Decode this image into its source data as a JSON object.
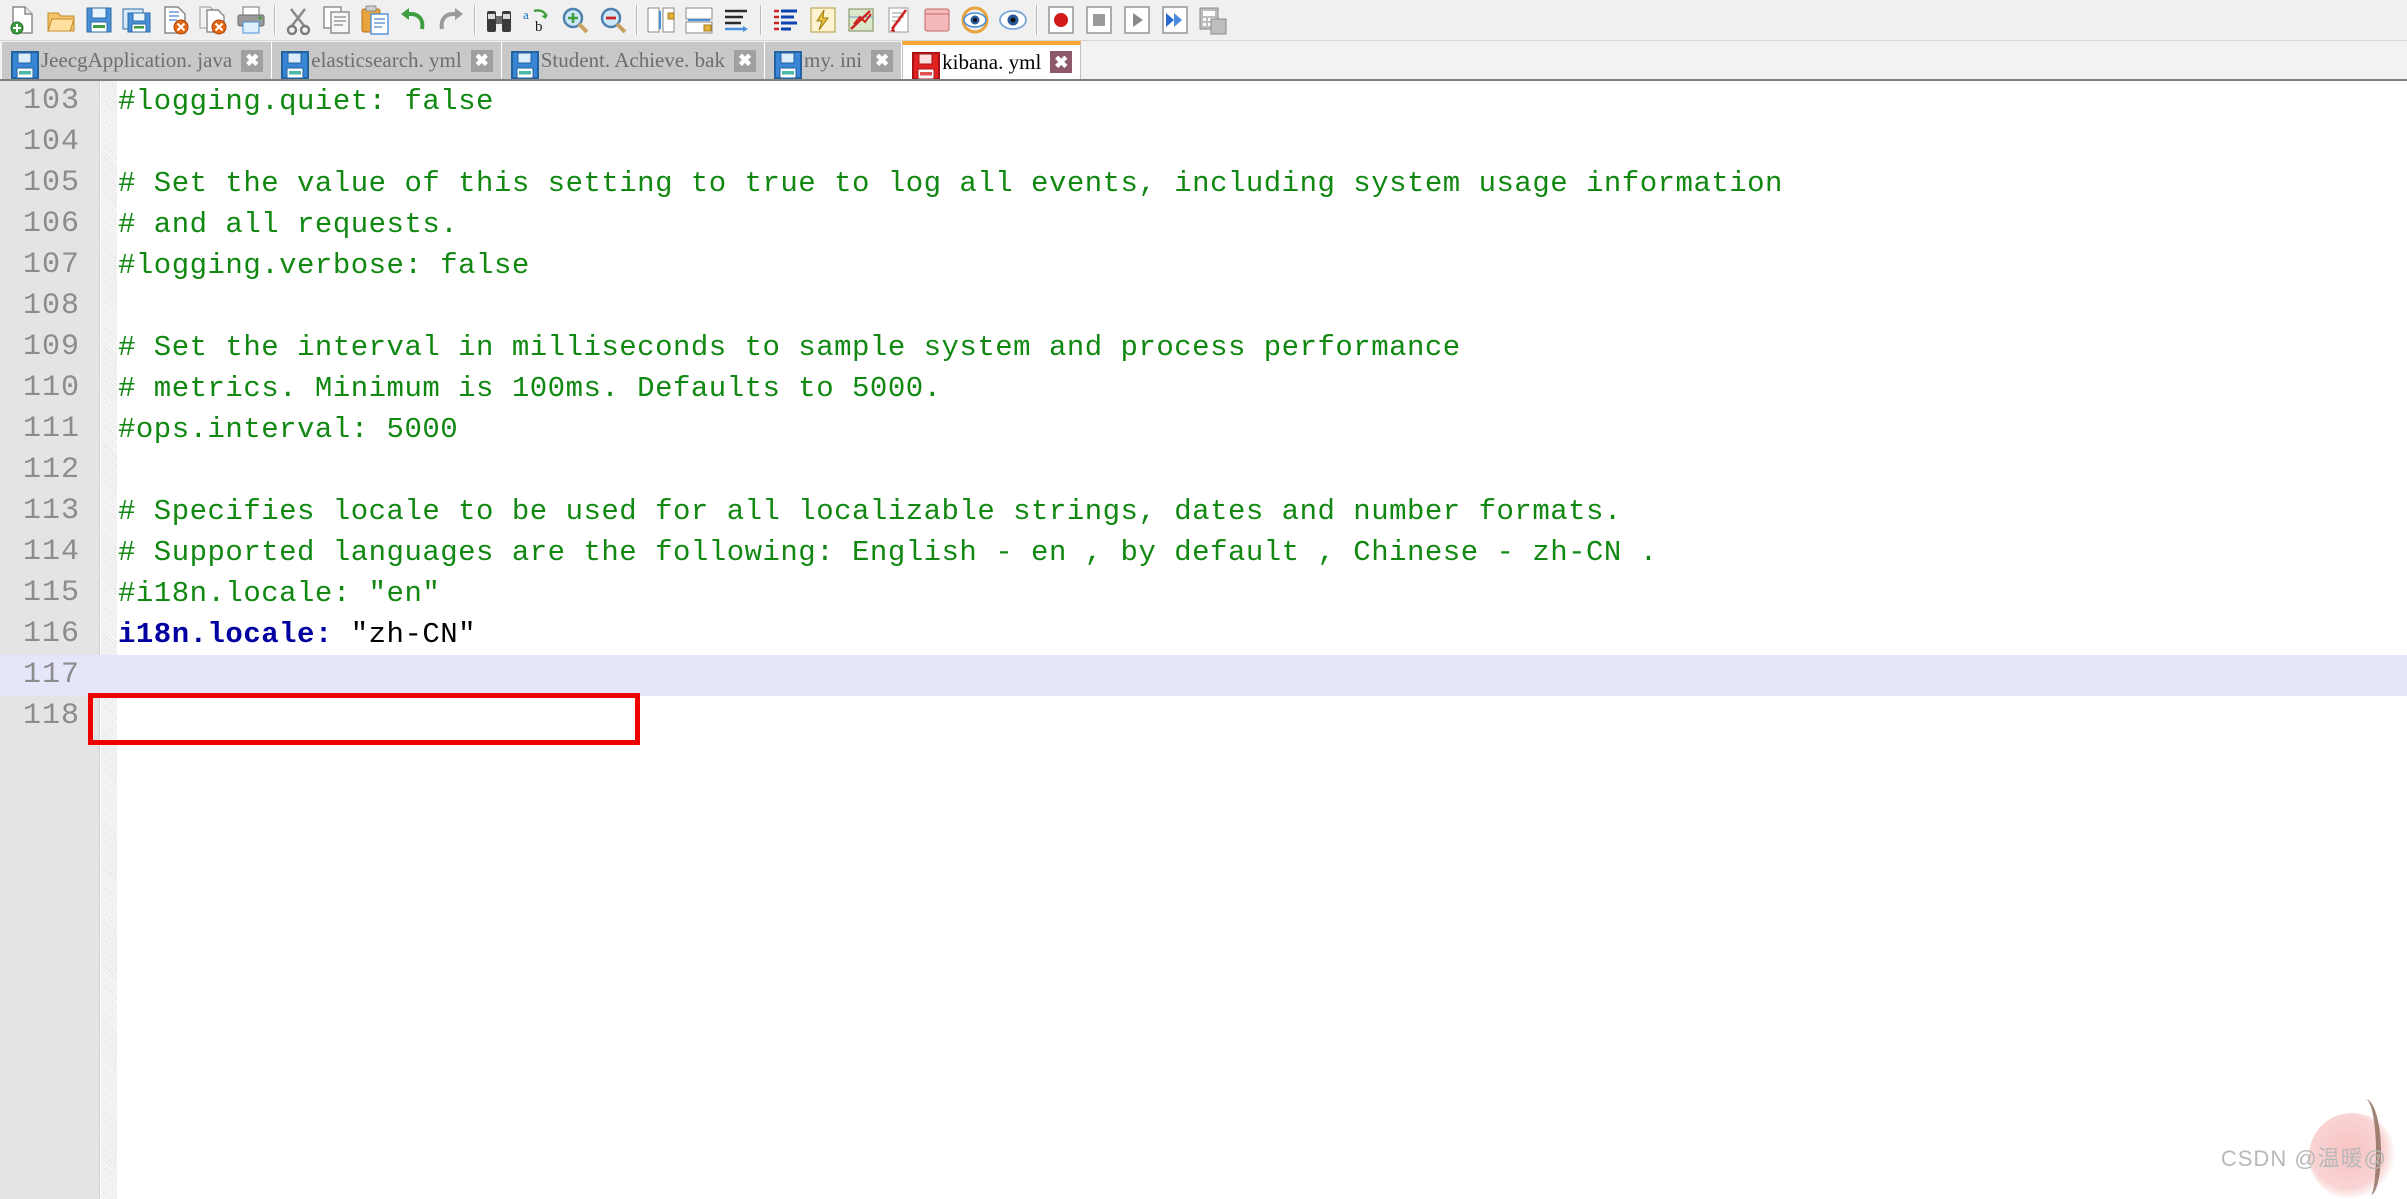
{
  "toolbar": {
    "groups": [
      {
        "buttons": [
          {
            "name": "new-file-button",
            "icon": "new-file-icon",
            "label": "New"
          },
          {
            "name": "open-file-button",
            "icon": "open-folder-icon",
            "label": "Open"
          },
          {
            "name": "save-button",
            "icon": "save-icon",
            "label": "Save"
          },
          {
            "name": "save-all-button",
            "icon": "save-all-icon",
            "label": "Save All"
          },
          {
            "name": "close-button",
            "icon": "close-document-icon",
            "label": "Close"
          },
          {
            "name": "close-all-button",
            "icon": "close-all-documents-icon",
            "label": "Close All"
          },
          {
            "name": "print-button",
            "icon": "printer-icon",
            "label": "Print"
          }
        ]
      },
      {
        "buttons": [
          {
            "name": "cut-button",
            "icon": "scissors-icon",
            "label": "Cut"
          },
          {
            "name": "copy-button",
            "icon": "copy-icon",
            "label": "Copy"
          },
          {
            "name": "paste-button",
            "icon": "paste-icon",
            "label": "Paste"
          },
          {
            "name": "undo-button",
            "icon": "undo-arrow-icon",
            "label": "Undo"
          },
          {
            "name": "redo-button",
            "icon": "redo-arrow-icon",
            "label": "Redo"
          }
        ]
      },
      {
        "buttons": [
          {
            "name": "find-button",
            "icon": "binoculars-icon",
            "label": "Find"
          },
          {
            "name": "replace-button",
            "icon": "replace-icon",
            "label": "Replace"
          },
          {
            "name": "zoom-in-button",
            "icon": "magnifier-plus-icon",
            "label": "Zoom In"
          },
          {
            "name": "zoom-out-button",
            "icon": "magnifier-minus-icon",
            "label": "Zoom Out"
          }
        ]
      },
      {
        "buttons": [
          {
            "name": "sync-vertical-scroll-button",
            "icon": "sync-vertical-icon",
            "label": "Sync Vertical Scrolling"
          },
          {
            "name": "sync-horizontal-scroll-button",
            "icon": "sync-horizontal-icon",
            "label": "Sync Horizontal Scrolling"
          },
          {
            "name": "word-wrap-button",
            "icon": "word-wrap-icon",
            "label": "Word Wrap"
          }
        ]
      },
      {
        "buttons": [
          {
            "name": "show-all-characters-button",
            "icon": "show-all-chars-icon",
            "label": "Show All Characters"
          },
          {
            "name": "show-indent-guide-button",
            "icon": "indent-guide-icon",
            "label": "Show Indent Guide"
          },
          {
            "name": "user-defined-dialog-button",
            "icon": "udl-dialog-icon",
            "label": "User-Defined Dialogue"
          },
          {
            "name": "document-map-button",
            "icon": "document-map-icon",
            "label": "Document Map"
          },
          {
            "name": "function-list-button",
            "icon": "function-list-icon",
            "label": "Function List"
          },
          {
            "name": "folder-as-workspace-button",
            "icon": "folder-workspace-icon",
            "label": "Folder as Workspace"
          },
          {
            "name": "monitoring-button",
            "icon": "eye-monitor-icon",
            "label": "Monitoring"
          }
        ]
      },
      {
        "buttons": [
          {
            "name": "record-macro-button",
            "icon": "record-circle-icon",
            "label": "Start Recording"
          },
          {
            "name": "stop-macro-button",
            "icon": "stop-square-icon",
            "label": "Stop Recording"
          },
          {
            "name": "play-macro-button",
            "icon": "play-triangle-icon",
            "label": "Playback"
          },
          {
            "name": "run-macro-multiple-button",
            "icon": "fast-forward-icon",
            "label": "Run a Macro Multiple Times"
          },
          {
            "name": "save-macro-button",
            "icon": "save-macro-icon",
            "label": "Save Current Recorded Macro"
          }
        ]
      }
    ]
  },
  "tabs": [
    {
      "label": "JeecgApplication. java",
      "active": false,
      "modified": false,
      "close": "✖"
    },
    {
      "label": "elasticsearch. yml",
      "active": false,
      "modified": false,
      "close": "✖"
    },
    {
      "label": "Student. Achieve. bak",
      "active": false,
      "modified": false,
      "close": "✖"
    },
    {
      "label": "my. ini",
      "active": false,
      "modified": false,
      "close": "✖"
    },
    {
      "label": "kibana. yml",
      "active": true,
      "modified": true,
      "close": "✖"
    }
  ],
  "editor": {
    "current_line": 117,
    "lines": [
      {
        "no": "103",
        "segments": [
          {
            "text": "#logging.quiet: false",
            "style": "cmt"
          }
        ]
      },
      {
        "no": "104",
        "segments": []
      },
      {
        "no": "105",
        "segments": [
          {
            "text": "# Set the value of this setting to true to log all events, including system usage information",
            "style": "cmt"
          }
        ]
      },
      {
        "no": "106",
        "segments": [
          {
            "text": "# and all requests.",
            "style": "cmt"
          }
        ]
      },
      {
        "no": "107",
        "segments": [
          {
            "text": "#logging.verbose: false",
            "style": "cmt"
          }
        ]
      },
      {
        "no": "108",
        "segments": []
      },
      {
        "no": "109",
        "segments": [
          {
            "text": "# Set the interval in milliseconds to sample system and process performance",
            "style": "cmt"
          }
        ]
      },
      {
        "no": "110",
        "segments": [
          {
            "text": "# metrics. Minimum is 100ms. Defaults to 5000.",
            "style": "cmt"
          }
        ]
      },
      {
        "no": "111",
        "segments": [
          {
            "text": "#ops.interval: 5000",
            "style": "cmt"
          }
        ]
      },
      {
        "no": "112",
        "segments": []
      },
      {
        "no": "113",
        "segments": [
          {
            "text": "# Specifies locale to be used for all localizable strings, dates and number formats.",
            "style": "cmt"
          }
        ]
      },
      {
        "no": "114",
        "segments": [
          {
            "text": "# Supported languages are the following: English - en , by default , Chinese - zh-CN .",
            "style": "cmt"
          }
        ]
      },
      {
        "no": "115",
        "segments": [
          {
            "text": "#i18n.locale: \"en\"",
            "style": "cmt"
          }
        ]
      },
      {
        "no": "116",
        "segments": [
          {
            "text": "i18n.locale:",
            "style": "key"
          },
          {
            "text": " \"zh-CN\"",
            "style": "val"
          }
        ]
      },
      {
        "no": "117",
        "segments": []
      },
      {
        "no": "118",
        "segments": []
      }
    ]
  },
  "annotation": {
    "name": "red-highlight-rectangle",
    "targets_line": "116",
    "color": "#ee0000"
  },
  "watermark": {
    "text": "CSDN @温暖@"
  },
  "colors": {
    "comment": "#118811",
    "keyword": "#0000a0",
    "value": "#000000",
    "gutter_bg": "#e4e4e4",
    "line_number": "#8c8c8c",
    "current_line_bg": "#e6e6fa",
    "active_tab_accent": "#f7a933",
    "toolbar_bg": "#f0f0f0",
    "inactive_tab_bg": "#c8c8c8"
  }
}
